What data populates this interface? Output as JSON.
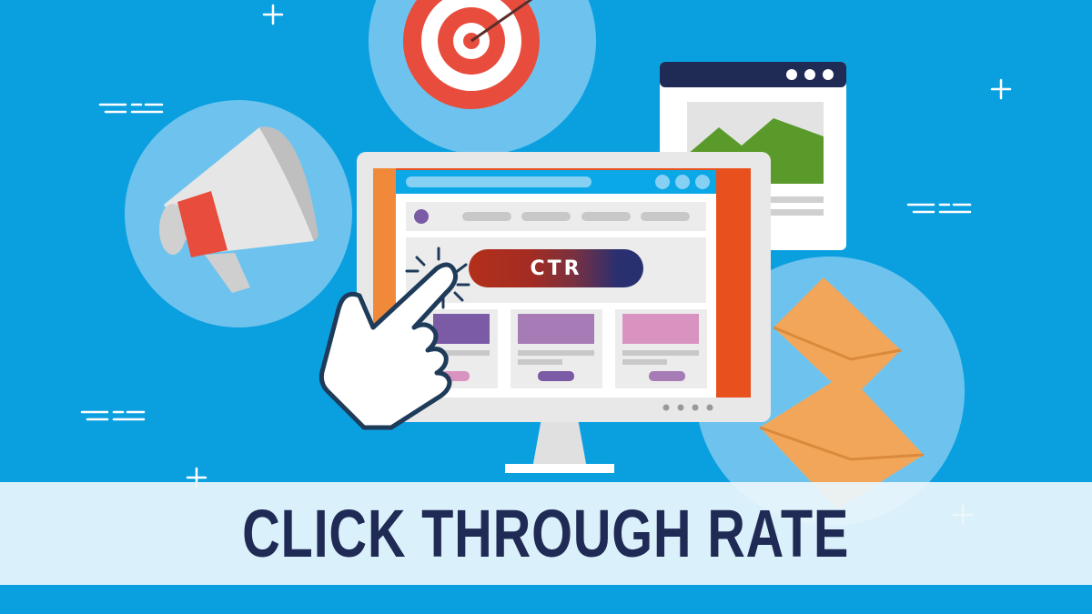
{
  "banner": {
    "title": "CLICK THROUGH RATE"
  },
  "screen": {
    "cta_label": "CTR"
  },
  "colors": {
    "background": "#0aa0e0",
    "banner_text": "#1f2a55",
    "target_red": "#e84c3d",
    "monitor_orange": "#e8501e",
    "envelope": "#f2a65a"
  }
}
